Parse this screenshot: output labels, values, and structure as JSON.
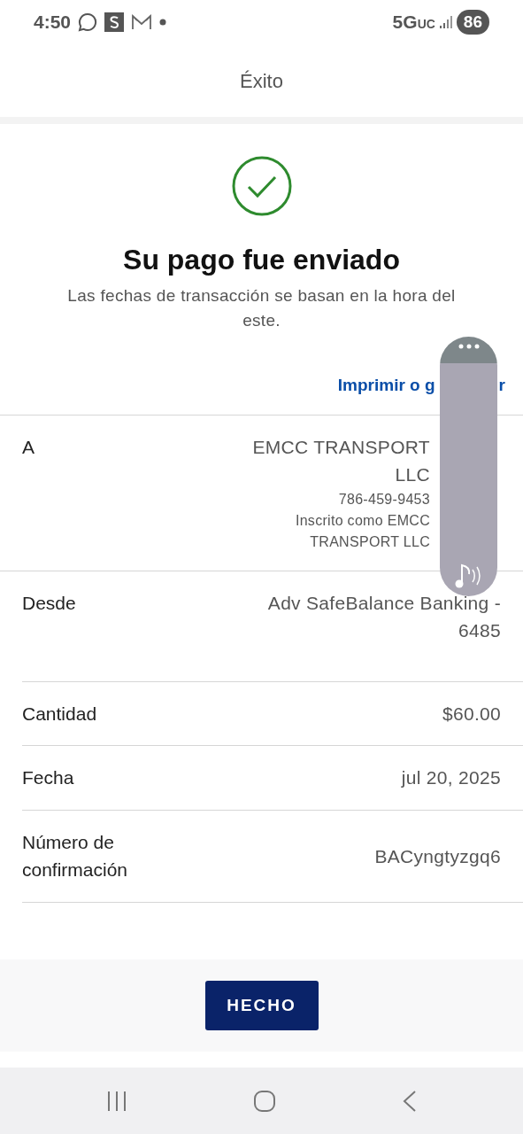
{
  "status_bar": {
    "time": "4:50",
    "network": "5G",
    "network_suffix": "UC",
    "battery": "86"
  },
  "header": {
    "title": "Éxito"
  },
  "confirmation": {
    "title": "Su pago fue enviado",
    "note": "Las fechas de transacción se basan en la hora del este."
  },
  "print_link": {
    "parts": [
      "Imprimir o g",
      "r"
    ]
  },
  "details": [
    {
      "kind": "payee",
      "label": "A",
      "lines": [
        "EMCC TRANSPORT LLC",
        "786-459-9453",
        "Inscrito como EMCC TRANSPORT LLC"
      ]
    },
    {
      "kind": "plain",
      "label": "Desde",
      "lines": [
        "Adv SafeBalance Banking - 6485"
      ]
    },
    {
      "kind": "plain",
      "label": "Cantidad",
      "lines": [
        "$60.00"
      ]
    },
    {
      "kind": "plain",
      "label": "Fecha",
      "lines": [
        "jul 20, 2025"
      ]
    },
    {
      "kind": "plain",
      "label": "Número de confirmación",
      "lines": [
        "BACyngtyzgq6"
      ]
    }
  ],
  "done_button": {
    "label": "HECHO"
  }
}
